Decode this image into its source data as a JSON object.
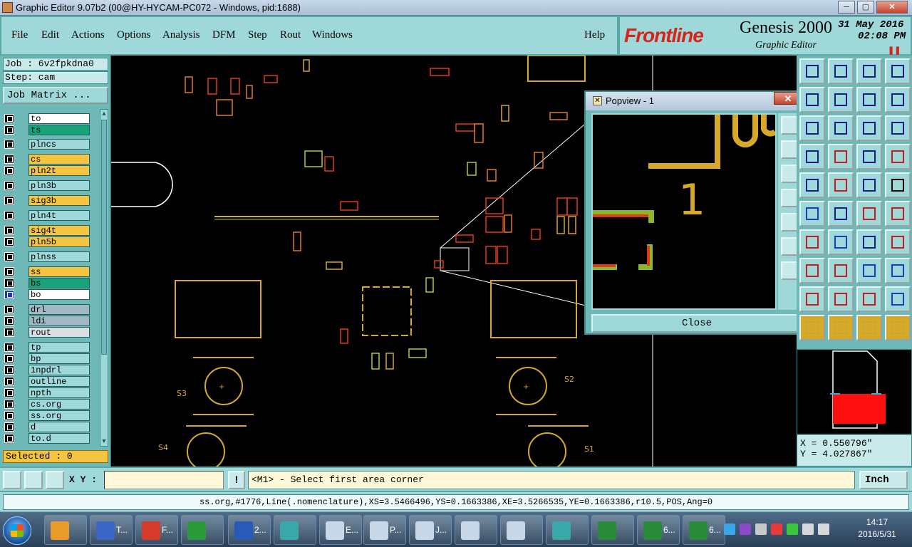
{
  "window": {
    "title": "Graphic Editor 9.07b2 (00@HY-HYCAM-PC072 - Windows, pid:1688)",
    "minimize": "─",
    "maximize": "▢",
    "close": "✕"
  },
  "menu": {
    "file": "File",
    "edit": "Edit",
    "actions": "Actions",
    "options": "Options",
    "analysis": "Analysis",
    "dfm": "DFM",
    "step": "Step",
    "rout": "Rout",
    "windows": "Windows",
    "help": "Help"
  },
  "brand": {
    "logo": "Frontline",
    "product": "Genesis 2000",
    "subtitle": "Graphic Editor",
    "date": "31 May 2016",
    "time": "02:08 PM",
    "indicator": "❚❚"
  },
  "job": {
    "job_line": "Job : 6v2fpkdna0",
    "step_line": "Step: cam",
    "matrix_button": "Job Matrix ..."
  },
  "layers": [
    {
      "name": "to",
      "color": "#ffffff"
    },
    {
      "name": "ts",
      "color": "#1aa37a"
    },
    {
      "name": "plncs",
      "color": "#9fd8d8"
    },
    {
      "name": "cs",
      "color": "#f5c542"
    },
    {
      "name": "pln2t",
      "color": "#f5c542"
    },
    {
      "name": "pln3b",
      "color": "#9fd8d8"
    },
    {
      "name": "sig3b",
      "color": "#f5c542"
    },
    {
      "name": "pln4t",
      "color": "#9fd8d8"
    },
    {
      "name": "sig4t",
      "color": "#f5c542"
    },
    {
      "name": "pln5b",
      "color": "#f5c542"
    },
    {
      "name": "plnss",
      "color": "#9fd8d8"
    },
    {
      "name": "ss",
      "color": "#f5c542"
    },
    {
      "name": "bs",
      "color": "#1aa37a"
    },
    {
      "name": "bo",
      "color": "#ffffff"
    },
    {
      "name": "drl",
      "color": "#9fb8c2"
    },
    {
      "name": "ldi",
      "color": "#9fb8c2"
    },
    {
      "name": "rout",
      "color": "#d8dfe2"
    },
    {
      "name": "tp",
      "color": "#9fd8d8"
    },
    {
      "name": "bp",
      "color": "#9fd8d8"
    },
    {
      "name": "1npdrl",
      "color": "#9fd8d8"
    },
    {
      "name": "outline",
      "color": "#9fd8d8"
    },
    {
      "name": "npth",
      "color": "#9fd8d8"
    },
    {
      "name": "cs.org",
      "color": "#9fd8d8"
    },
    {
      "name": "ss.org",
      "color": "#9fd8d8"
    },
    {
      "name": "d",
      "color": "#9fd8d8"
    },
    {
      "name": "to.d",
      "color": "#9fd8d8"
    }
  ],
  "selected": "Selected : 0",
  "popview": {
    "title": "Popview - 1",
    "close_button": "Close",
    "close_x": "✕"
  },
  "canvas_labels": {
    "s3": "S3",
    "s4": "S4",
    "s1": "S1",
    "s2": "S2",
    "pop_1": "1"
  },
  "coordinates": {
    "x": "X = 0.550796\"",
    "y": "Y = 4.027867\""
  },
  "command": {
    "xy_label": "X Y :",
    "xy_value": "",
    "bang": "!",
    "prompt": "<M1> - Select first area corner",
    "unit": "Inch"
  },
  "status": "ss.org,#1776,Line(.nomenclature),XS=3.5466496,YS=0.1663386,XE=3.5266535,YE=0.1663386,r10.5,POS,Ang=0",
  "taskbar": {
    "items": [
      {
        "label": "",
        "color": "#e89a2a"
      },
      {
        "label": "T...",
        "color": "#3a66c8"
      },
      {
        "label": "F...",
        "color": "#d63a2a"
      },
      {
        "label": "",
        "color": "#2a9a3a"
      },
      {
        "label": "2...",
        "color": "#2a5ab8"
      },
      {
        "label": "",
        "color": "#3aa8a8"
      },
      {
        "label": "E...",
        "color": "#c8d8e8"
      },
      {
        "label": "P...",
        "color": "#c8d8e8"
      },
      {
        "label": "J...",
        "color": "#c8d8e8"
      },
      {
        "label": "",
        "color": "#c8d8e8"
      },
      {
        "label": "",
        "color": "#c8d8e8"
      },
      {
        "label": "",
        "color": "#3aa8a8"
      },
      {
        "label": "",
        "color": "#2a8a3a"
      },
      {
        "label": "6...",
        "color": "#2a8a3a"
      },
      {
        "label": "6...",
        "color": "#2a8a3a"
      }
    ],
    "clock_time": "14:17",
    "clock_date": "2016/5/31"
  }
}
